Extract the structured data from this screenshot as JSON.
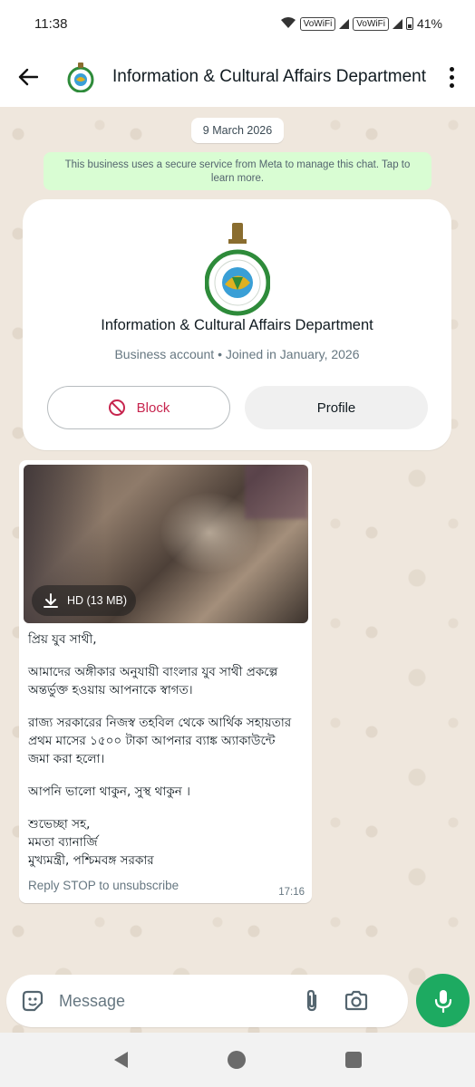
{
  "status_bar": {
    "time": "11:38",
    "network_label_1": "VoWiFi",
    "network_label_2": "VoWiFi",
    "battery": "41%"
  },
  "header": {
    "title": "Information & Cultural Affairs Department"
  },
  "chat": {
    "date": "9 March 2026",
    "meta_notice": "This business uses a secure service from Meta to manage this chat. Tap to learn more.",
    "business_card": {
      "name": "Information & Cultural Affairs Department",
      "subtitle": "Business account • Joined in January, 2026",
      "block_label": "Block",
      "profile_label": "Profile"
    },
    "message": {
      "media_download_label": "HD (13 MB)",
      "greeting": "প্রিয় যুব সাথী,",
      "paragraph_1": "আমাদের অঙ্গীকার অনুযায়ী বাংলার যুব সাথী প্রকল্পে অন্তর্ভুক্ত হওয়ায় আপনাকে স্বাগত।",
      "paragraph_2": "রাজ্য সরকারের নিজস্ব তহবিল থেকে আর্থিক সহায়তার প্রথম মাসের ১৫০০ টাকা আপনার ব্যাঙ্ক অ্যাকাউন্টে জমা করা হলো।",
      "paragraph_3": "আপনি ভালো থাকুন, সুস্থ থাকুন ।",
      "signoff_1": "শুভেচ্ছা সহ,",
      "signoff_2": "মমতা ব্যানার্জি",
      "signoff_3": "মুখ্যমন্ত্রী, পশ্চিমবঙ্গ সরকার",
      "reply_stop": "Reply STOP to unsubscribe",
      "time": "17:16"
    }
  },
  "composer": {
    "placeholder": "Message"
  },
  "colors": {
    "accent_green": "#1daa61",
    "block_red": "#c7254e",
    "notice_bg": "#d9fdd3"
  }
}
